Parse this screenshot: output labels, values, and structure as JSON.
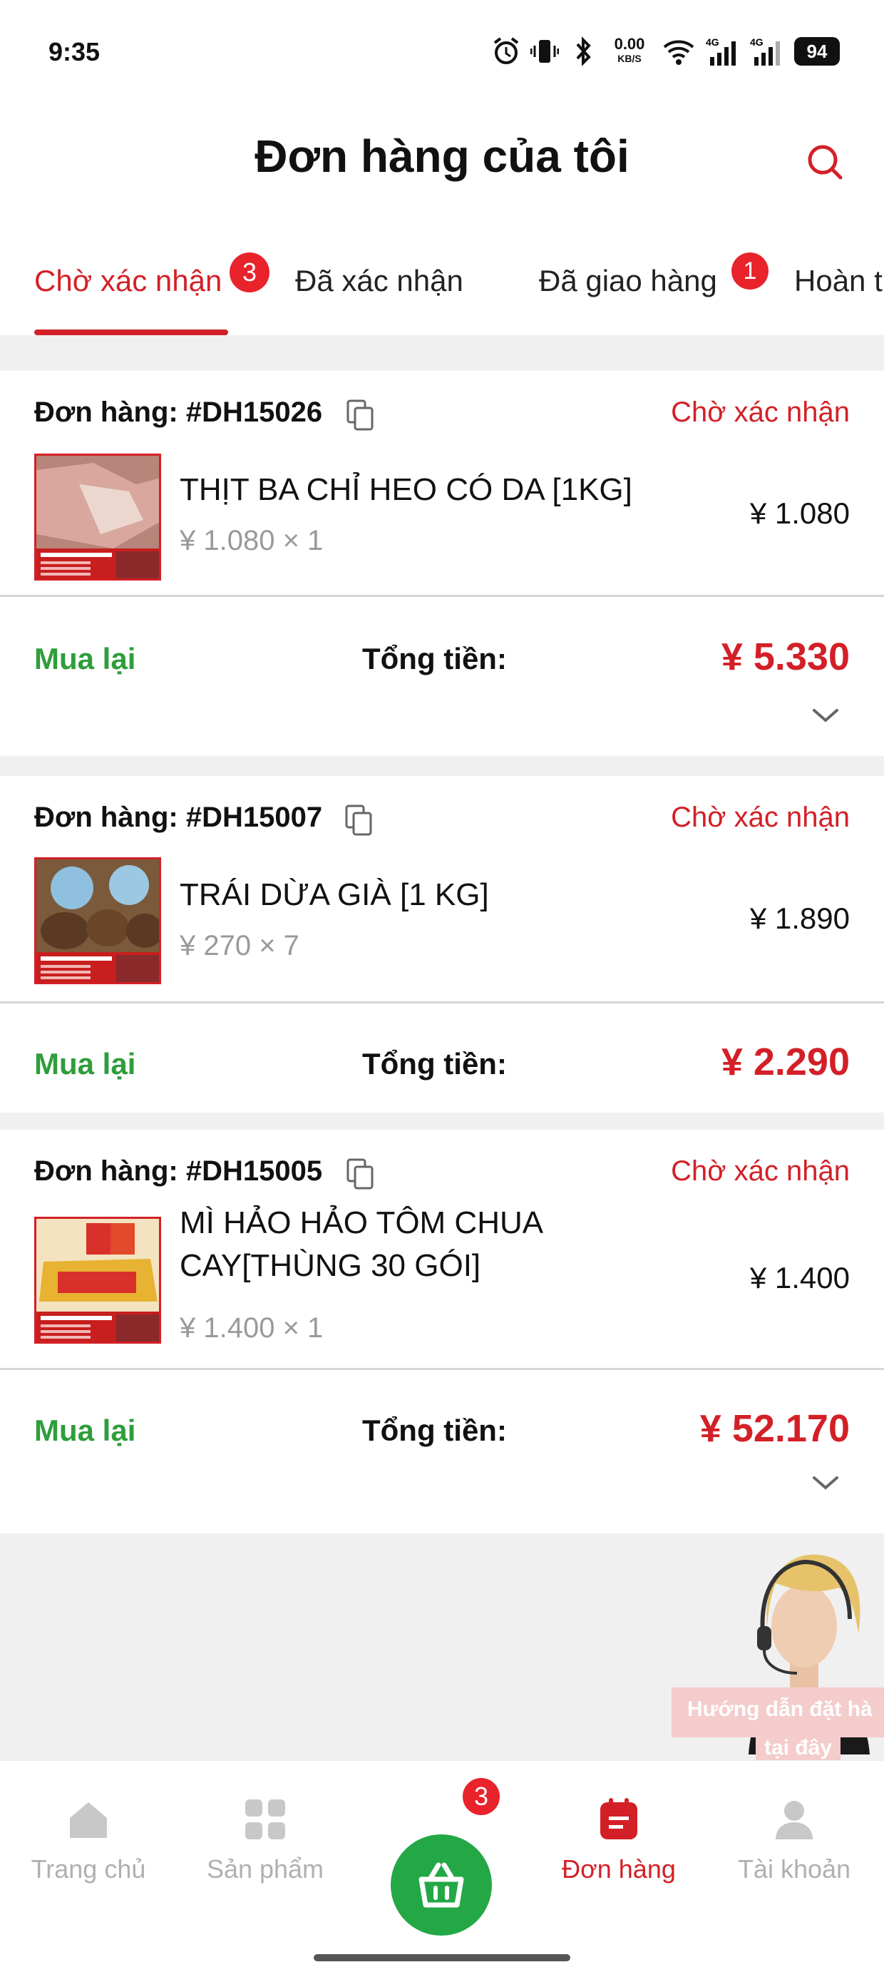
{
  "status_bar": {
    "time": "9:35",
    "net_speed": "0.00",
    "net_unit": "KB/S",
    "battery": "94",
    "signal_label": "4G"
  },
  "header": {
    "title": "Đơn hàng của tôi"
  },
  "tabs": [
    {
      "label": "Chờ xác nhận",
      "badge": "3",
      "active": true
    },
    {
      "label": "Đã xác nhận"
    },
    {
      "label": "Đã giao hàng",
      "badge": "1"
    },
    {
      "label": "Hoàn t"
    }
  ],
  "orders": [
    {
      "id": "Đơn hàng: #DH15026",
      "status": "Chờ xác nhận",
      "product_name": "THỊT BA CHỈ HEO CÓ DA [1KG]",
      "product_qty": "¥ 1.080 × 1",
      "product_price": "¥ 1.080",
      "rebuy": "Mua lại",
      "total_label": "Tổng tiền:",
      "total": "¥ 5.330"
    },
    {
      "id": "Đơn hàng: #DH15007",
      "status": "Chờ xác nhận",
      "product_name": "TRÁI DỪA GIÀ [1 KG]",
      "product_qty": "¥ 270 × 7",
      "product_price": "¥ 1.890",
      "rebuy": "Mua lại",
      "total_label": "Tổng tiền:",
      "total": "¥ 2.290"
    },
    {
      "id": "Đơn hàng: #DH15005",
      "status": "Chờ xác nhận",
      "product_name_line1": "MÌ HẢO HẢO TÔM CHUA",
      "product_name_line2": "CAY[THÙNG 30 GÓI]",
      "product_qty": "¥ 1.400 × 1",
      "product_price": "¥ 1.400",
      "rebuy": "Mua lại",
      "total_label": "Tổng tiền:",
      "total": "¥ 52.170"
    }
  ],
  "support": {
    "line1": "Hướng dẫn đặt hà",
    "line2": "tại đây"
  },
  "bottom_nav": {
    "home": "Trang chủ",
    "products": "Sản phẩm",
    "cart_badge": "3",
    "orders": "Đơn hàng",
    "account": "Tài khoản"
  },
  "colors": {
    "accent_red": "#d32027",
    "green": "#2e9e3a",
    "cart_green": "#23a845",
    "muted": "#b0b0b0"
  }
}
